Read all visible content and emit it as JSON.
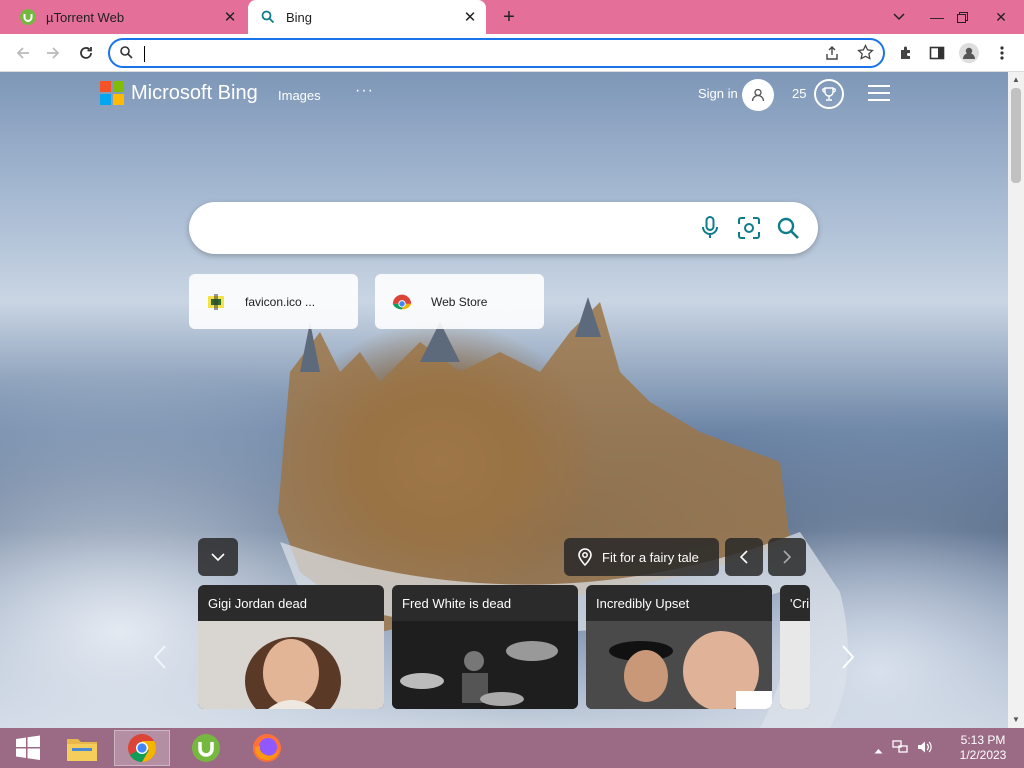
{
  "tabs": [
    {
      "title": "µTorrent Web",
      "favicon": "utorrent-icon",
      "active": false
    },
    {
      "title": "Bing",
      "favicon": "bing-search-icon",
      "active": true
    }
  ],
  "window_controls": [
    "chevron-down-icon",
    "minimize-icon",
    "restore-icon",
    "close-icon"
  ],
  "address_bar": {
    "value": "",
    "placeholder": ""
  },
  "bing": {
    "logo_text": "Microsoft Bing",
    "nav_images": "Images",
    "nav_more": "···",
    "sign_in": "Sign in",
    "points": "25",
    "search_value": "",
    "quick_links": [
      {
        "label": "favicon.ico ...",
        "icon": "favicon-icon"
      },
      {
        "label": "Web Store",
        "icon": "chrome-web-store-icon"
      }
    ],
    "image_caption": "Fit for a fairy tale",
    "news_cards": [
      {
        "title": "Gigi Jordan dead"
      },
      {
        "title": "Fred White is dead"
      },
      {
        "title": "Incredibly Upset"
      },
      {
        "title": "'Cri"
      }
    ]
  },
  "taskbar": {
    "items": [
      "start-icon",
      "file-explorer-icon",
      "chrome-icon",
      "utorrent-icon",
      "firefox-icon"
    ],
    "clock_time": "5:13 PM",
    "clock_date": "1/2/2023"
  },
  "colors": {
    "tabbar": "#e4709a",
    "omnibox_border": "#1a73e8",
    "bing_accent": "#0f7c8c",
    "taskbar": "#9b6a84"
  }
}
